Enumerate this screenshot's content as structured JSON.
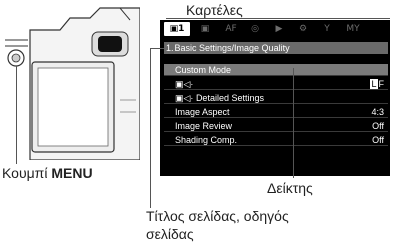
{
  "callouts": {
    "tabs": "Καρτέλες",
    "menu_button_prefix": "Κουμπί ",
    "menu_button_bold": "MENU",
    "cursor": "Δείκτης",
    "page_title": "Τίτλος σελίδας, οδηγός",
    "page_title_line2": "σελίδας"
  },
  "menu": {
    "tabs": [
      {
        "label": "1",
        "icon": "camera-icon"
      },
      {
        "label": "",
        "icon": "camera-video-icon"
      },
      {
        "label": "AF",
        "icon": ""
      },
      {
        "label": "",
        "icon": "video-icon"
      },
      {
        "label": "",
        "icon": "playback-icon"
      },
      {
        "label": "",
        "icon": "gear-icon"
      },
      {
        "label": "",
        "icon": "wrench-icon"
      },
      {
        "label": "MY",
        "icon": ""
      }
    ],
    "page_number": "1.",
    "page_title": "Basic Settings/Image Quality",
    "rows": [
      {
        "label": "Custom Mode",
        "value": ""
      },
      {
        "label": "",
        "value": "F"
      },
      {
        "label": "Detailed Settings",
        "value": ""
      },
      {
        "label": "Image Aspect",
        "value": "4:3"
      },
      {
        "label": "Image Review",
        "value": "Off"
      },
      {
        "label": "Shading Comp.",
        "value": "Off"
      }
    ]
  }
}
